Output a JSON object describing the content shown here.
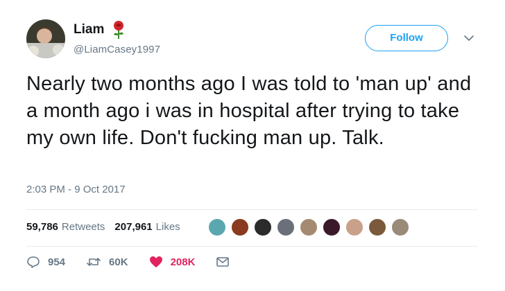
{
  "author": {
    "display_name": "Liam",
    "handle": "@LiamCasey1997",
    "emoji_icon": "rose-icon"
  },
  "follow_label": "Follow",
  "tweet": {
    "text": "Nearly two months ago I was told to 'man up' and a month ago i was in hospital after trying to take my own life. Don't fucking man up. Talk.",
    "timestamp": "2:03 PM - 9 Oct 2017"
  },
  "stats": {
    "retweets_count": "59,786",
    "retweets_label": "Retweets",
    "likes_count": "207,961",
    "likes_label": "Likes"
  },
  "actions": {
    "reply_count": "954",
    "retweet_count": "60K",
    "like_count": "208K"
  },
  "colors": {
    "brand": "#1da1f2",
    "like": "#e0245e",
    "secondary_text": "#657786",
    "divider": "#e6ecf0"
  },
  "liker_avatars": [
    {
      "color": "#5aa7b0"
    },
    {
      "color": "#8a3a1e"
    },
    {
      "color": "#2b2b2b"
    },
    {
      "color": "#6b6f7a"
    },
    {
      "color": "#a58a72"
    },
    {
      "color": "#3a1a2a"
    },
    {
      "color": "#c9a08a"
    },
    {
      "color": "#7a5a3a"
    },
    {
      "color": "#9a8a7a"
    }
  ]
}
